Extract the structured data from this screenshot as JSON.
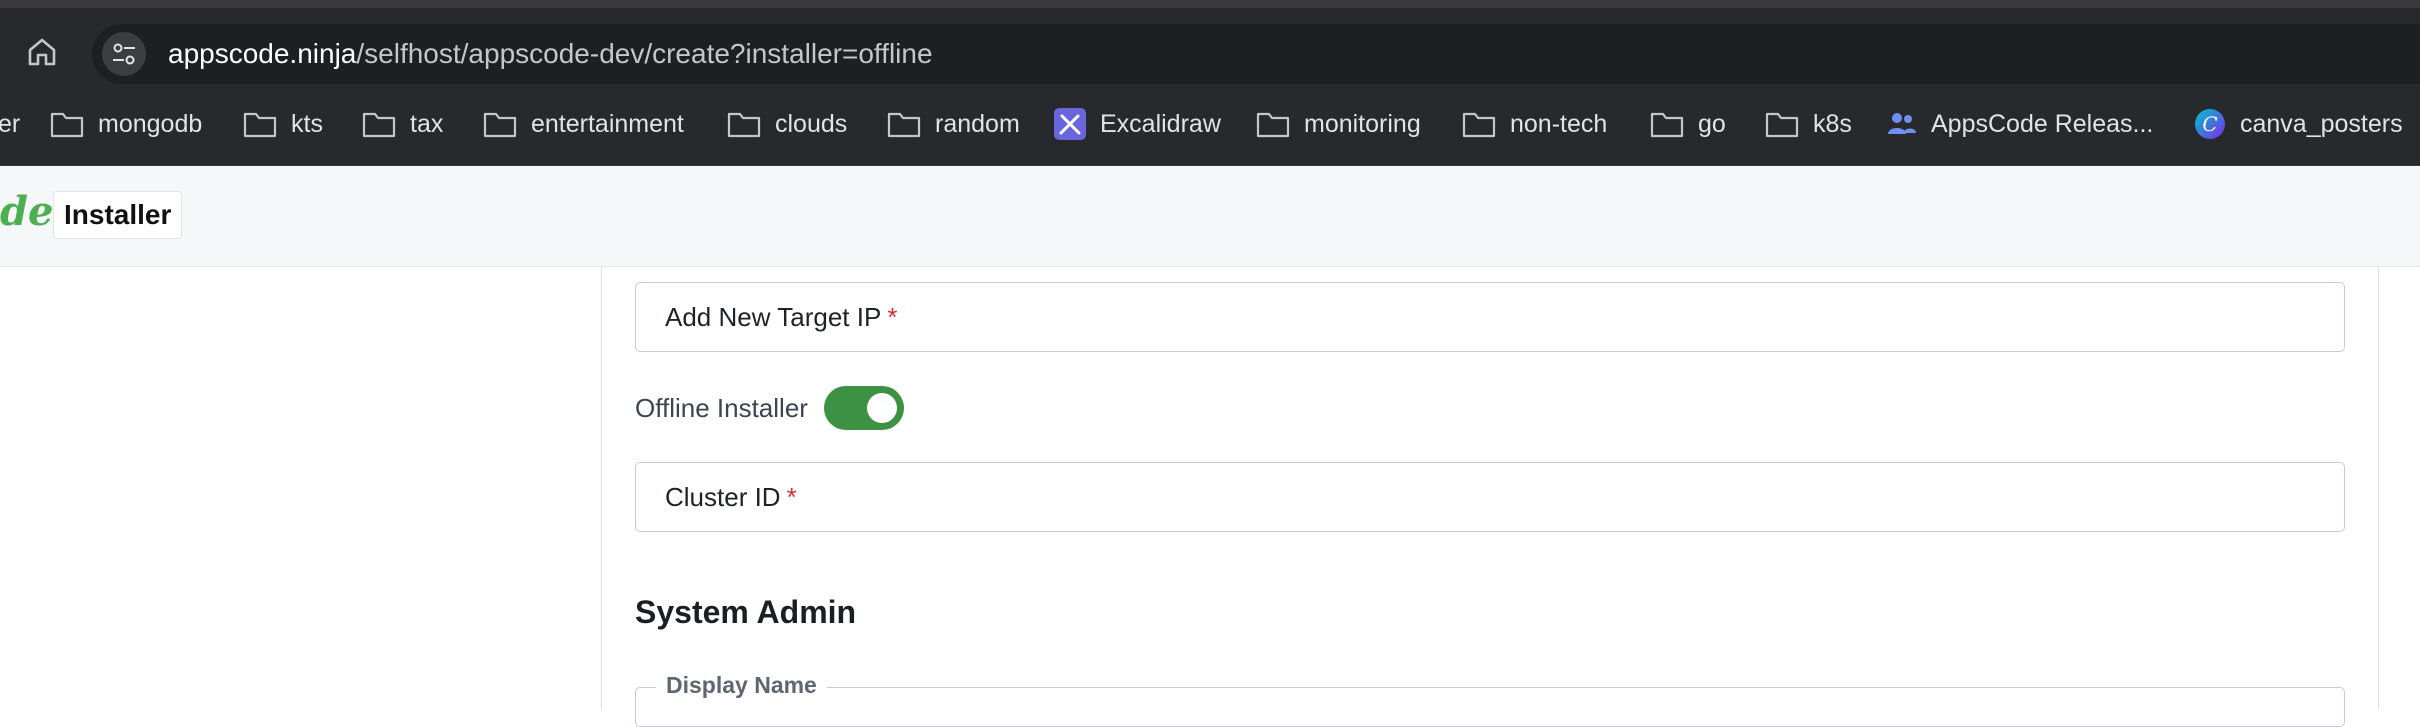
{
  "browser": {
    "url_host": "appscode.ninja",
    "url_path": "/selfhost/appscode-dev/create?installer=offline",
    "bookmarks": [
      {
        "label": "er",
        "icon": "none"
      },
      {
        "label": "mongodb",
        "icon": "folder-icon"
      },
      {
        "label": "kts",
        "icon": "folder-icon"
      },
      {
        "label": "tax",
        "icon": "folder-icon"
      },
      {
        "label": "entertainment",
        "icon": "folder-icon"
      },
      {
        "label": "clouds",
        "icon": "folder-icon"
      },
      {
        "label": "random",
        "icon": "folder-icon"
      },
      {
        "label": "Excalidraw",
        "icon": "excalidraw-icon"
      },
      {
        "label": "monitoring",
        "icon": "folder-icon"
      },
      {
        "label": "non-tech",
        "icon": "folder-icon"
      },
      {
        "label": "go",
        "icon": "folder-icon"
      },
      {
        "label": "k8s",
        "icon": "folder-icon"
      },
      {
        "label": "AppsCode Releas...",
        "icon": "people-icon"
      },
      {
        "label": "canva_posters",
        "icon": "canva-icon"
      }
    ]
  },
  "header": {
    "logo_fragment": "de",
    "installer_label": "Installer"
  },
  "form": {
    "target_ip_label": "Add New Target IP",
    "required_mark": "*",
    "offline_installer_label": "Offline Installer",
    "offline_installer_enabled": true,
    "cluster_id_label": "Cluster ID",
    "system_admin_title": "System Admin",
    "display_name_label": "Display Name"
  },
  "colors": {
    "toggle_on": "#3d9142",
    "brand_green": "#4caf50",
    "required": "#d32f2f"
  }
}
